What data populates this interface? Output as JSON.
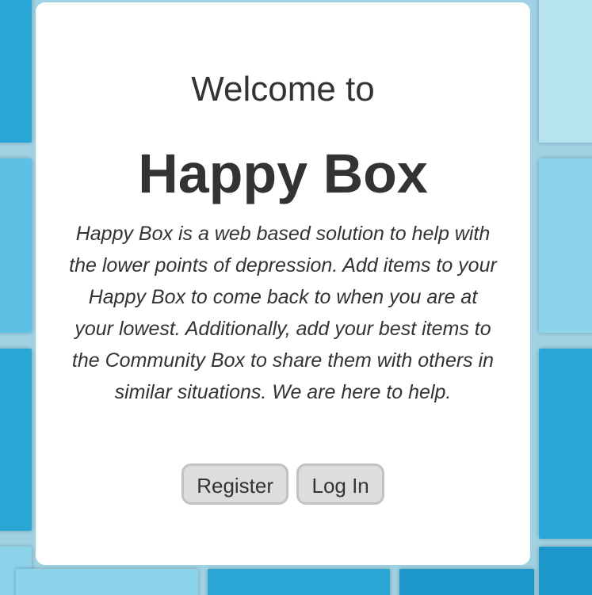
{
  "background": {
    "colors": [
      "#2aa6d6",
      "#5cc1e4",
      "#8dd3ea",
      "#b7e3ef",
      "#1d96c9"
    ]
  },
  "card": {
    "welcome": "Welcome to",
    "title": "Happy Box",
    "description": "Happy Box is a web based solution to help with the lower points of depression. Add items to your Happy Box to come back to when you are at your lowest. Additionally, add your best items to the Community Box to share them with others in similar situations. We are here to help."
  },
  "actions": {
    "register_label": "Register",
    "login_label": "Log In"
  }
}
